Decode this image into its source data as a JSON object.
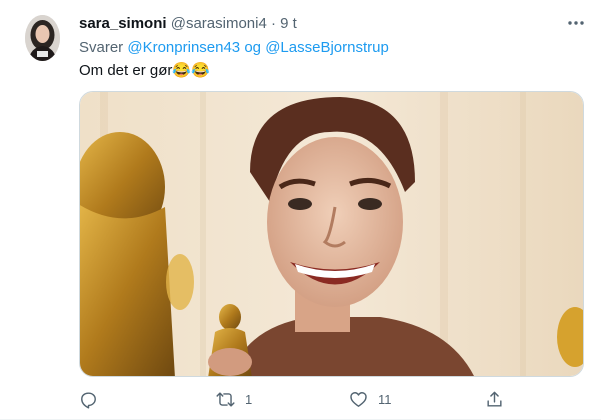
{
  "tweet": {
    "display_name": "sara_simoni",
    "handle": "@sarasimoni4",
    "separator": "·",
    "time": "9 t",
    "replying_prefix": "Svarer",
    "mention_1": "@Kronprinsen43",
    "replying_joiner": "og",
    "mention_2": "@LasseBjornstrup",
    "text": "Om det er gør",
    "emoji": "😂😂"
  },
  "actions": {
    "reply_icon": "reply-icon",
    "retweet_icon": "retweet-icon",
    "retweet_count": "1",
    "like_icon": "heart-icon",
    "like_count": "11",
    "share_icon": "share-icon"
  },
  "colors": {
    "link": "#1d9bf0",
    "secondary_text": "#536471"
  }
}
